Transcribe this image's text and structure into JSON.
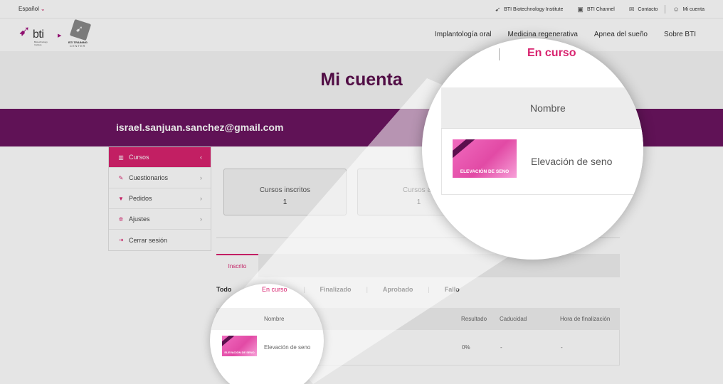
{
  "topbar": {
    "language": "Español",
    "links": [
      {
        "label": "BTI Biotechnology Institute",
        "icon": "bird-icon"
      },
      {
        "label": "BTI Channel",
        "icon": "tv-icon"
      },
      {
        "label": "Contacto",
        "icon": "mail-icon"
      },
      {
        "label": "Mi cuenta",
        "icon": "user-icon"
      }
    ]
  },
  "header": {
    "logo_word": "bti",
    "logo_sub": "Biotechnology Institute",
    "training_logo_title": "BTI TRAINING",
    "training_logo_sub": "CENTER",
    "nav": [
      "Implantología oral",
      "Medicina regenerativa",
      "Apnea del sueño",
      "Sobre BTI"
    ]
  },
  "page": {
    "title": "Mi cuenta",
    "user_email": "israel.sanjuan.sanchez@gmail.com"
  },
  "sidebar": {
    "items": [
      {
        "label": "Cursos",
        "icon": "book-icon",
        "active": true
      },
      {
        "label": "Cuestionarios",
        "icon": "quiz-icon",
        "active": false
      },
      {
        "label": "Pedidos",
        "icon": "cart-icon",
        "active": false
      },
      {
        "label": "Ajustes",
        "icon": "gear-icon",
        "active": false
      },
      {
        "label": "Cerrar sesión",
        "icon": "logout-icon",
        "active": false
      }
    ]
  },
  "stats": [
    {
      "label": "Cursos inscritos",
      "value": "1"
    },
    {
      "label": "Cursos ac",
      "value": "1"
    }
  ],
  "tabs": {
    "active": "Inscrito"
  },
  "filters": [
    "Todo",
    "En curso",
    "Finalizado",
    "Aprobado",
    "Fallo"
  ],
  "filter_active": "En curso",
  "table": {
    "columns": [
      "Nombre",
      "Resultado",
      "Caducidad",
      "Hora de finalización"
    ],
    "rows": [
      {
        "thumb_text": "ELEVACIÓN DE SENO",
        "name": "Elevación de seno",
        "result": "0%",
        "expiry": "-",
        "finish": "-"
      }
    ]
  },
  "colors": {
    "accent": "#d8236f",
    "brand_purple": "#6b1560",
    "title_purple": "#5b0f4d"
  }
}
